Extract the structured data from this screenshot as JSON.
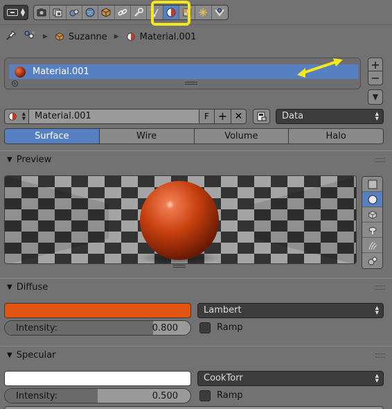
{
  "header": {
    "editor_icon": "properties-editor-icon",
    "context_tabs": [
      {
        "name": "render-tab",
        "icon": "camera-icon"
      },
      {
        "name": "render-layers-tab",
        "icon": "render-layers-icon"
      },
      {
        "name": "scene-tab",
        "icon": "scene-icon"
      },
      {
        "name": "world-tab",
        "icon": "world-icon"
      },
      {
        "name": "object-tab",
        "icon": "cube-icon"
      },
      {
        "name": "constraints-tab",
        "icon": "constraint-icon"
      },
      {
        "name": "modifiers-tab",
        "icon": "wrench-icon"
      },
      {
        "name": "object-data-tab",
        "icon": "mesh-data-icon"
      },
      {
        "name": "material-tab",
        "icon": "material-icon",
        "active": true
      },
      {
        "name": "texture-tab",
        "icon": "texture-icon"
      },
      {
        "name": "particles-tab",
        "icon": "particles-icon"
      },
      {
        "name": "physics-tab",
        "icon": "physics-icon"
      }
    ]
  },
  "breadcrumb": {
    "object": "Suzanne",
    "material": "Material.001"
  },
  "slots": {
    "items": [
      "Material.001"
    ],
    "add_label": "+",
    "remove_label": "−"
  },
  "datablock": {
    "name": "Material.001",
    "fake_user": "F",
    "new_label": "+",
    "unlink_label": "✕",
    "link": "Data"
  },
  "type_tabs": [
    "Surface",
    "Wire",
    "Volume",
    "Halo"
  ],
  "preview": {
    "title": "Preview"
  },
  "diffuse": {
    "title": "Diffuse",
    "color": "#e0540f",
    "shader": "Lambert",
    "intensity_label": "Intensity:",
    "intensity": "0.800",
    "intensity_value": 0.8,
    "ramp_label": "Ramp"
  },
  "specular": {
    "title": "Specular",
    "color": "#ffffff",
    "shader": "CookTorr",
    "intensity_label": "Intensity:",
    "intensity": "0.500",
    "intensity_value": 0.5,
    "ramp_label": "Ramp"
  },
  "colors": {
    "accent": "#5680c2",
    "annotation": "#f5e81a"
  }
}
